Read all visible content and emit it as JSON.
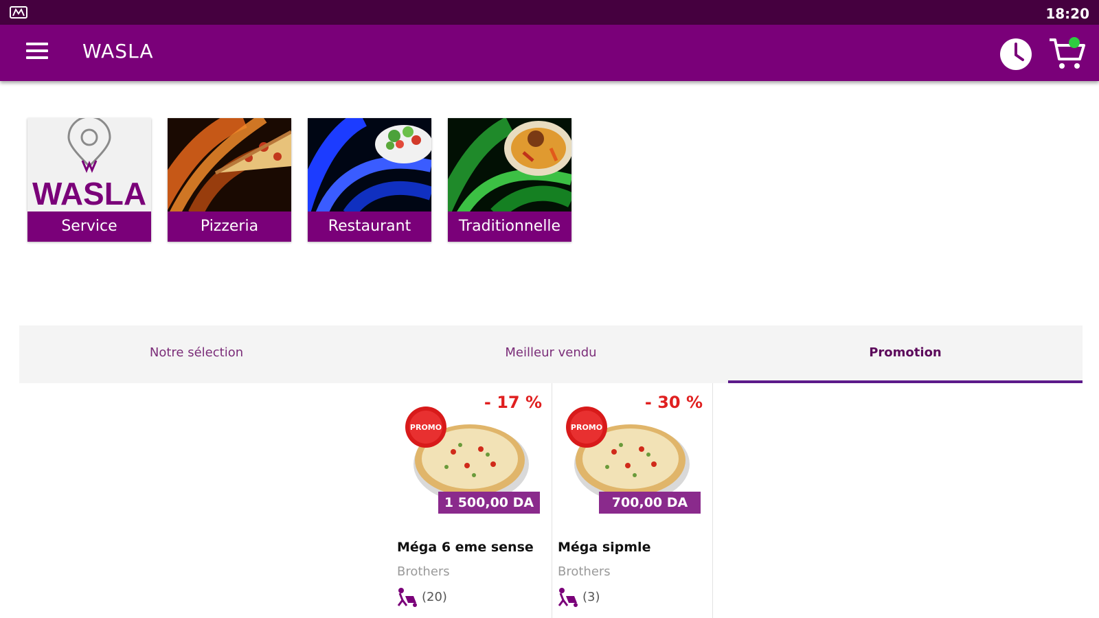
{
  "status_bar": {
    "time": "18:20",
    "left_icon": "notification-icon"
  },
  "app_bar": {
    "title": "WASLA",
    "icons": [
      "menu-icon",
      "clock-icon",
      "cart-icon"
    ],
    "cart_dot_color": "#2ecc40"
  },
  "categories": [
    {
      "label": "Service",
      "logo_text": "WASLA",
      "image": "wasla-logo"
    },
    {
      "label": "Pizzeria",
      "image": "pizza-slice"
    },
    {
      "label": "Restaurant",
      "image": "salad-bowl"
    },
    {
      "label": "Traditionnelle",
      "image": "tajine"
    }
  ],
  "tabs": [
    {
      "label": "Notre sélection",
      "active": false
    },
    {
      "label": "Meilleur vendu",
      "active": false
    },
    {
      "label": "Promotion",
      "active": true
    }
  ],
  "products": [
    {
      "name": "Méga 6 eme sense",
      "brand": "Brothers",
      "price": "1 500,00 DA",
      "discount": "- 17 %",
      "badge": "PROMO",
      "reviews": "(20)"
    },
    {
      "name": "Méga sipmle",
      "brand": "Brothers",
      "price": "700,00 DA",
      "discount": "- 30 %",
      "badge": "PROMO",
      "reviews": "(3)"
    }
  ],
  "colors": {
    "primary": "#7a0079",
    "status_bar": "#45003f",
    "tab_indicator": "#5c1a8a",
    "discount": "#e02020"
  }
}
